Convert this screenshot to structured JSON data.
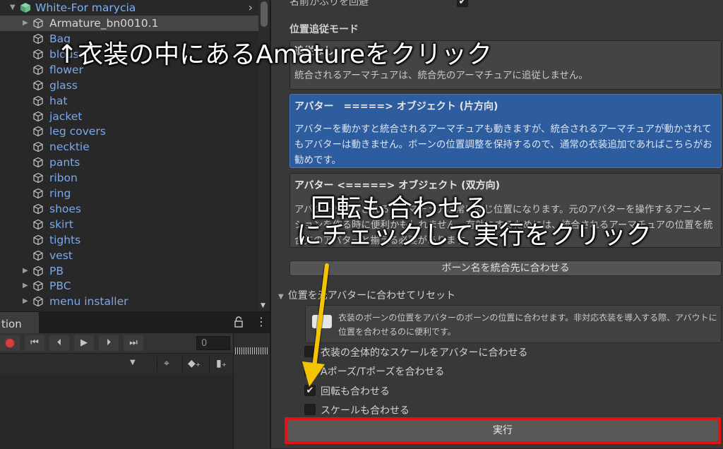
{
  "hierarchy": {
    "root": "White-For marycia",
    "armature": "Armature_bn0010.1",
    "items": [
      "Bag",
      "blouse",
      "flower",
      "glass",
      "hat",
      "jacket",
      "leg covers",
      "necktie",
      "pants",
      "ribon",
      "ring",
      "shoes",
      "skirt",
      "tights",
      "vest",
      "PB",
      "PBC",
      "menu installer"
    ]
  },
  "animation": {
    "tab_label": "tion",
    "frame_value": "0"
  },
  "inspector": {
    "avoid_name_collision_label": "名前かぶりを回避",
    "position_mode_header": "位置追従モード",
    "modes": [
      {
        "title": "追従なし",
        "desc": "統合されるアーマチュアは、統合先のアーマチュアに追従しません。"
      },
      {
        "title": "アバター　=====> オブジェクト (片方向)",
        "desc": "アバターを動かすと統合されるアーマチュアも動きますが、統合されるアーマチュアが動かされてもアバターは動きません。ボーンの位置調整を保持するので、通常の衣装追加であればこちらがお勧めです。"
      },
      {
        "title": "アバター <=====> オブジェクト (双方向)",
        "desc": "アバターと統合されるアーマチュアは常に同じ位置になります。元のアバターを操作するアニメーションを作る時に便利かもしれません。有効にするためには、統合されるアーマチュアの位置を統合先のアバターと揃える必要があります。"
      }
    ],
    "bone_name_button": "ボーン名を統合先に合わせる",
    "reset_foldout": "位置を元アバターに合わせてリセット",
    "help_text": "衣装のボーンの位置をアバターのボーンの位置に合わせます。非対応衣装を導入する際、アバウトに位置を合わせるのに便利です。",
    "options": [
      {
        "label": "衣装の全体的なスケールをアバターに合わせる",
        "checked": false
      },
      {
        "label": "Aポーズ/Tポーズを合わせる",
        "checked": false
      },
      {
        "label": "回転も合わせる",
        "checked": true
      },
      {
        "label": "スケールも合わせる",
        "checked": false
      }
    ],
    "execute_button": "実行"
  },
  "annotations": {
    "top": "↑衣装の中にあるAmatureをクリック",
    "middle_line1": "回転も合わせる",
    "middle_line2": "にチェックして実行をクリック",
    "arrow_color": "#f5c400",
    "highlight_color": "#e01414"
  }
}
